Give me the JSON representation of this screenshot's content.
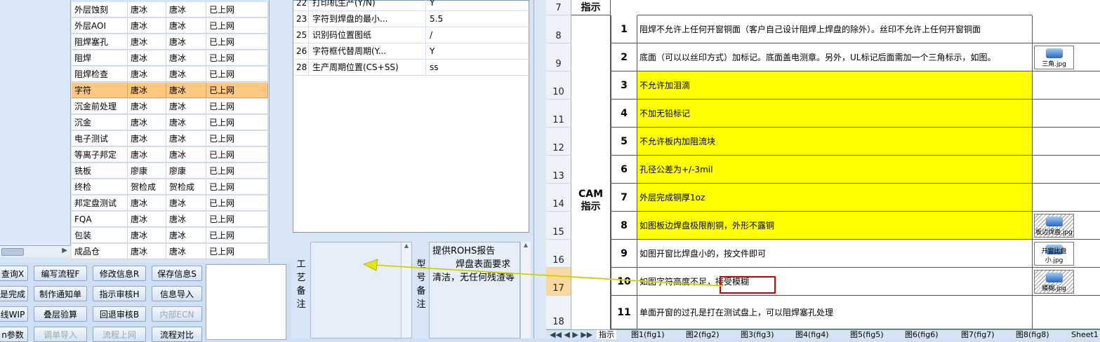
{
  "process_table": {
    "rows": [
      [
        "外层蚀刻",
        "唐冰",
        "唐冰",
        "已上网"
      ],
      [
        "外层AOI",
        "唐冰",
        "唐冰",
        "已上网"
      ],
      [
        "阻焊塞孔",
        "唐冰",
        "唐冰",
        "已上网"
      ],
      [
        "阻焊",
        "唐冰",
        "唐冰",
        "已上网"
      ],
      [
        "阻焊检查",
        "唐冰",
        "唐冰",
        "已上网"
      ],
      [
        "字符",
        "唐冰",
        "唐冰",
        "已上网"
      ],
      [
        "沉金前处理",
        "唐冰",
        "唐冰",
        "已上网"
      ],
      [
        "沉金",
        "唐冰",
        "唐冰",
        "已上网"
      ],
      [
        "电子测试",
        "唐冰",
        "唐冰",
        "已上网"
      ],
      [
        "等离子邦定",
        "唐冰",
        "唐冰",
        "已上网"
      ],
      [
        "铣板",
        "廖康",
        "廖康",
        "已上网"
      ],
      [
        "终检",
        "贺检成",
        "贺检成",
        "已上网"
      ],
      [
        "邦定盘测试",
        "唐冰",
        "唐冰",
        "已上网"
      ],
      [
        "FQA",
        "唐冰",
        "唐冰",
        "已上网"
      ],
      [
        "包装",
        "唐冰",
        "唐冰",
        "已上网"
      ],
      [
        "成品仓",
        "唐冰",
        "唐冰",
        "已上网"
      ]
    ],
    "selected_index": 5
  },
  "buttons": {
    "query": "查询X",
    "write_flow": "编写流程F",
    "modify_info": "修改信息R",
    "save_info": "保存信息S",
    "complete": "是完成",
    "make_notice": "制作通知单",
    "review_guide": "指示审核H",
    "import_info": "信息导入",
    "wip": "线WIP",
    "stack_calc": "叠层验算",
    "back_review": "回退审核B",
    "internal_ecn": "内部ECN",
    "params": "n参数",
    "import_order": "调单导入",
    "flow_online": "流程上网",
    "flow_compare": "流程对比"
  },
  "spec_list": {
    "rows": [
      [
        "22",
        "打印机生产(Y/N)",
        "Y"
      ],
      [
        "23",
        "字符到焊盘的最小...",
        "5.5"
      ],
      [
        "25",
        "识别码位置图纸",
        "/"
      ],
      [
        "26",
        "字符框代替周期(Y...",
        "Y"
      ],
      [
        "28",
        "生产周期位置(CS+SS)",
        "ss"
      ]
    ]
  },
  "remarks": {
    "craft_label": [
      "工",
      "艺",
      "备",
      "注"
    ],
    "model_label": [
      "型",
      "号",
      "备",
      "注"
    ],
    "model_text": "提供ROHS报告\n        焊盘表面要求清洁，无任何残渣等"
  },
  "sheet": {
    "header_title": "指示",
    "section_label_1": "CAM",
    "section_label_2": "指示",
    "rows": [
      {
        "hdr": "7",
        "num": "",
        "text": "",
        "yellow": false,
        "img": ""
      },
      {
        "hdr": "8",
        "num": "1",
        "text": "阻焊不允许上任何开窗铜面（客户自己设计阻焊上焊盘的除外）。丝印不允许上任何开窗铜面",
        "yellow": false,
        "img": ""
      },
      {
        "hdr": "9",
        "num": "2",
        "text": "底面（可以以丝印方式）加标记。底面盖电测章。另外，UL标记后面需加一个三角标示，如图。",
        "yellow": false,
        "img": "三角.jpg"
      },
      {
        "hdr": "10",
        "num": "3",
        "text": "不允许加泪滴",
        "yellow": true,
        "img": ""
      },
      {
        "hdr": "11",
        "num": "4",
        "text": "不加无铅标记",
        "yellow": true,
        "img": ""
      },
      {
        "hdr": "12",
        "num": "5",
        "text": "不允许板内加阻流块",
        "yellow": true,
        "img": ""
      },
      {
        "hdr": "13",
        "num": "6",
        "text": "孔径公差为+/-3mil",
        "yellow": true,
        "img": ""
      },
      {
        "hdr": "14",
        "num": "7",
        "text": "外层完成铜厚1oz",
        "yellow": true,
        "img": ""
      },
      {
        "hdr": "15",
        "num": "8",
        "text": "如图板边焊盘极限削铜，外形不露铜",
        "yellow": true,
        "img": "板边焊盘.jpg"
      },
      {
        "hdr": "16",
        "num": "9",
        "text": "如图开窗比焊盘小的，按文件即可",
        "yellow": false,
        "img": "开窗比盘小.jpg"
      },
      {
        "hdr": "17",
        "num": "10",
        "text": "如图字符高度不足，接受模糊",
        "yellow": false,
        "img": "模糊.jpg"
      },
      {
        "hdr": "18",
        "num": "11",
        "text": "单面开窗的过孔是打在测试盘上，可以阻焊塞孔处理",
        "yellow": false,
        "img": ""
      }
    ],
    "highlight_text": "接受模糊"
  },
  "sheet_tabs": [
    "指示",
    "图1(fig1)",
    "图2(fig2)",
    "图3(fig3)",
    "图4(fig4)",
    "图5(fig5)",
    "图6(fig6)",
    "图7(fig7)",
    "图8(fig8)",
    "Sheet1"
  ],
  "colors": {
    "yellow": "#ffff00",
    "selection": "#ffc880",
    "arrow": "#e6e600",
    "callout": "#cc0000"
  }
}
